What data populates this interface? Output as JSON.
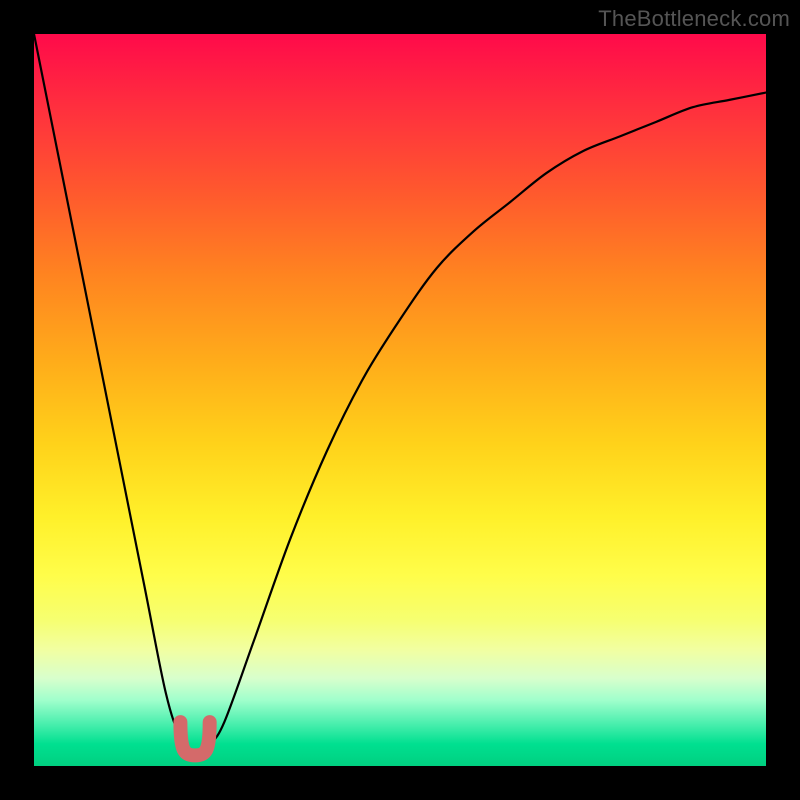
{
  "watermark": "TheBottleneck.com",
  "chart_data": {
    "type": "line",
    "title": "",
    "xlabel": "",
    "ylabel": "",
    "xlim": [
      0,
      100
    ],
    "ylim": [
      0,
      100
    ],
    "categories": [
      0,
      5,
      10,
      15,
      18,
      20,
      22,
      24,
      26,
      30,
      35,
      40,
      45,
      50,
      55,
      60,
      65,
      70,
      75,
      80,
      85,
      90,
      95,
      100
    ],
    "series": [
      {
        "name": "bottleneck-curve",
        "values": [
          100,
          75,
          50,
          25,
          10,
          4,
          2,
          3,
          6,
          17,
          31,
          43,
          53,
          61,
          68,
          73,
          77,
          81,
          84,
          86,
          88,
          90,
          91,
          92
        ]
      }
    ],
    "annotations": {
      "valley_marker": {
        "x_range": [
          20,
          24
        ],
        "y_range": [
          2,
          6
        ],
        "color": "#d66"
      }
    }
  }
}
